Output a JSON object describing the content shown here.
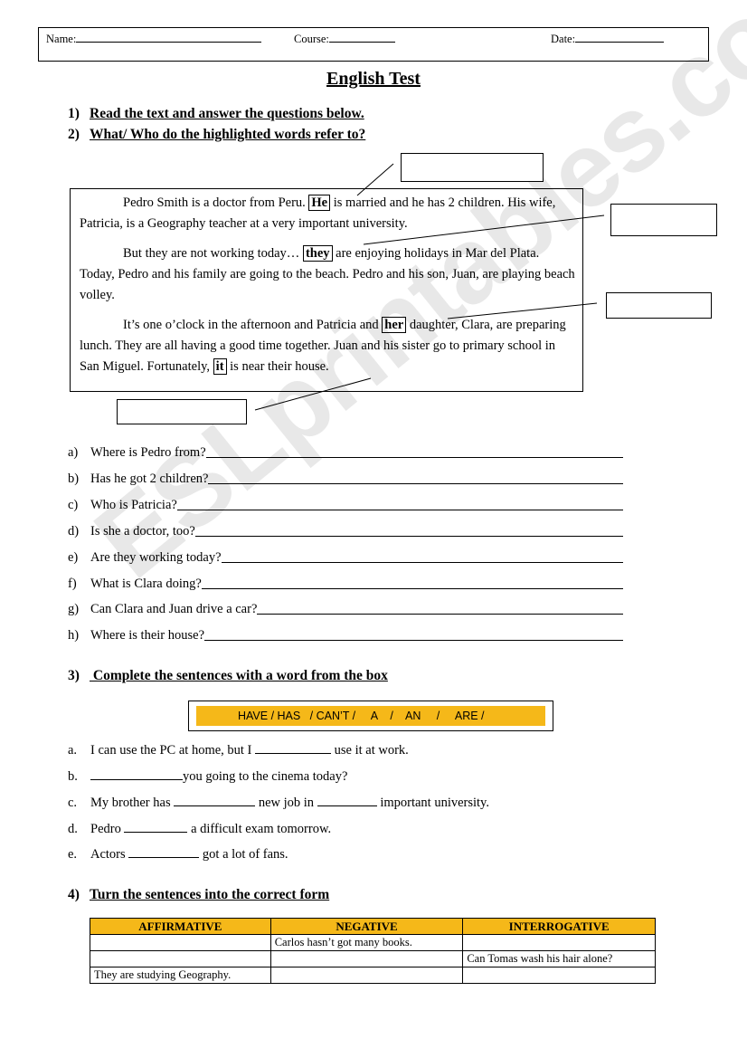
{
  "header": {
    "name_label": "Name:",
    "course_label": "Course:",
    "date_label": "Date:"
  },
  "title": "English Test",
  "instructions": [
    {
      "num": "1)",
      "text": "Read the text and answer the questions below."
    },
    {
      "num": "2)",
      "text": "What/ Who do the highlighted words refer to?"
    }
  ],
  "reading": {
    "p1_a": "Pedro Smith is a doctor from Peru. ",
    "p1_hl": "He",
    "p1_b": " is married and he has 2 children. His wife, Patricia, is a Geography teacher at a very important university.",
    "p2_a": "But they are not working today… ",
    "p2_hl": "they",
    "p2_b": " are enjoying holidays in Mar del Plata.  Today, Pedro and his family are going to the beach. Pedro and his son, Juan, are playing beach volley.",
    "p3_a": "It’s one o’clock in the afternoon and Patricia and ",
    "p3_hl": "her",
    "p3_b": " daughter, Clara, are preparing lunch. They are all having a good time together. Juan and his sister go to primary school in San Miguel. Fortunately, ",
    "p3_hl2": "it",
    "p3_c": " is near their house."
  },
  "questions": [
    {
      "letter": "a)",
      "text": "Where is Pedro from?"
    },
    {
      "letter": "b)",
      "text": "Has he got 2 children?"
    },
    {
      "letter": "c)",
      "text": "Who is Patricia?"
    },
    {
      "letter": "d)",
      "text": "Is she a doctor, too?"
    },
    {
      "letter": "e)",
      "text": "Are they working today?"
    },
    {
      "letter": "f)",
      "text": "What is Clara doing?"
    },
    {
      "letter": "g)",
      "text": "Can Clara and Juan drive a car?"
    },
    {
      "letter": "h)",
      "text": "Where is their house?"
    }
  ],
  "section3": {
    "num": "3)",
    "text": " Complete the sentences with a word from the box",
    "word_box": "HAVE / HAS   / CAN’T /     A    /    AN     /     ARE /",
    "sentences": [
      {
        "letter": "a.",
        "before": "I can use the PC at home, but I ",
        "after": " use it at work."
      },
      {
        "letter": "b.",
        "before": "",
        "after": "you going to the cinema today?"
      },
      {
        "letter": "c.",
        "before": "My brother has ",
        "middle": " new job in ",
        "after": " important university."
      },
      {
        "letter": "d.",
        "before": "Pedro ",
        "after": " a difficult exam tomorrow."
      },
      {
        "letter": "e.",
        "before": "Actors ",
        "after": " got a lot of fans."
      }
    ]
  },
  "section4": {
    "num": "4)",
    "text": "Turn the sentences into the correct form",
    "headers": [
      "AFFIRMATIVE",
      "NEGATIVE",
      "INTERROGATIVE"
    ],
    "rows": [
      [
        "",
        "Carlos hasn’t got many books.",
        ""
      ],
      [
        "",
        "",
        "Can Tomas wash his hair alone?"
      ],
      [
        "They are studying Geography.",
        "",
        ""
      ]
    ]
  },
  "watermark": "ESLprintables.com",
  "colors": {
    "accent": "#f5b819"
  }
}
